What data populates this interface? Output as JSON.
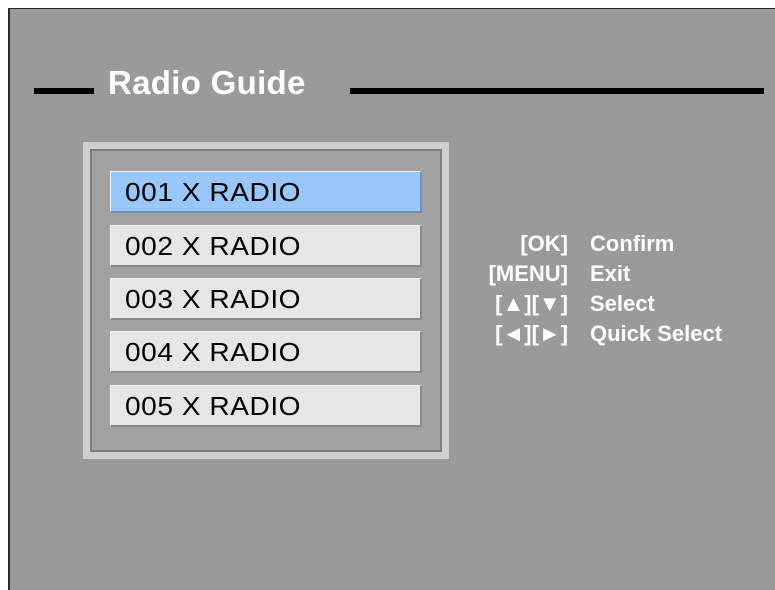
{
  "title": "Radio Guide",
  "colors": {
    "background": "#9a9a9a",
    "selected_item": "#99c7fb",
    "item": "#e6e6e6",
    "title_text": "#ffffff"
  },
  "channels": [
    {
      "label": "001 X RADIO",
      "selected": true
    },
    {
      "label": "002 X RADIO",
      "selected": false
    },
    {
      "label": "003 X RADIO",
      "selected": false
    },
    {
      "label": "004 X RADIO",
      "selected": false
    },
    {
      "label": "005 X RADIO",
      "selected": false
    }
  ],
  "help": [
    {
      "key": "[OK]",
      "action": "Confirm"
    },
    {
      "key": "[MENU]",
      "action": "Exit"
    },
    {
      "key": "[▲][▼]",
      "action": "Select"
    },
    {
      "key": "[◄][►]",
      "action": "Quick Select"
    }
  ]
}
